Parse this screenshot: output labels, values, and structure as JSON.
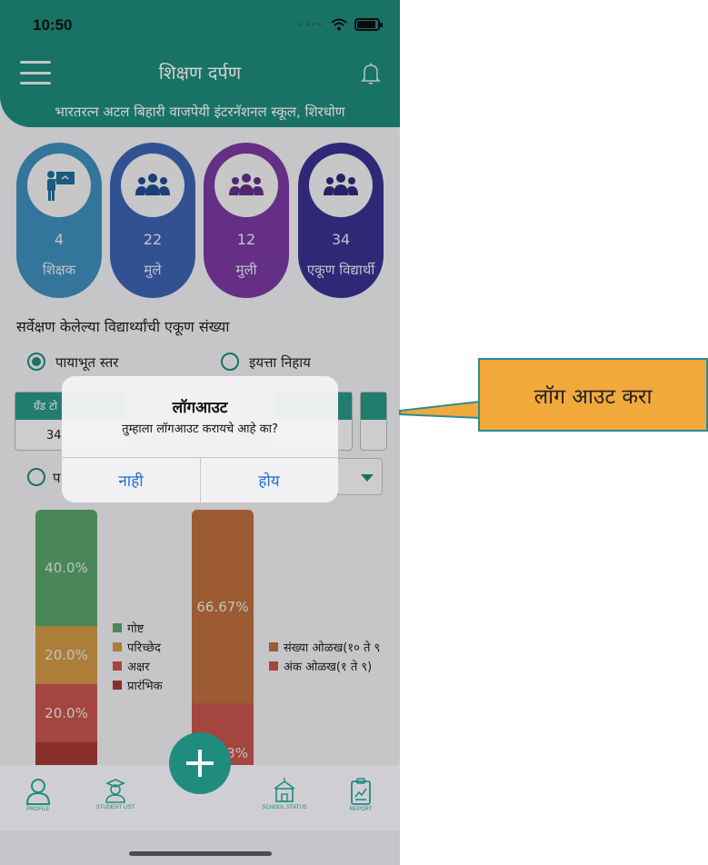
{
  "status_bar": {
    "time": "10:50"
  },
  "header": {
    "title": "शिक्षण दर्पण",
    "school": "भारतरत्न अटल बिहारी वाजपेयी इंटरनॅशनल स्कूल, शिरधोण"
  },
  "stats": [
    {
      "value": "4",
      "label": "शिक्षक",
      "color": "#3f8fbe",
      "icon": "teacher-icon"
    },
    {
      "value": "22",
      "label": "मुले",
      "color": "#3d63b3",
      "icon": "group-icon"
    },
    {
      "value": "12",
      "label": "मुली",
      "color": "#7a3aa1",
      "icon": "group-icon"
    },
    {
      "value": "34",
      "label": "एकूण विद्यार्थी",
      "color": "#3a3192",
      "icon": "group-icon"
    }
  ],
  "section": {
    "title": "सर्वेक्षण केलेल्या विद्यार्थ्यांची एकूण संख्या",
    "radio1": "पायाभूत स्तर",
    "radio2": "इयत्ता निहाय",
    "radio3_partial": "प",
    "table_head": "ग्रँड टो",
    "table_value": "34"
  },
  "chart_data": [
    {
      "type": "bar",
      "stacked": true,
      "series": [
        {
          "name": "गोष्ट",
          "value": 40.0,
          "label": "40.0%",
          "color": "#5aa56c"
        },
        {
          "name": "परिच्छेद",
          "value": 20.0,
          "label": "20.0%",
          "color": "#d39a47"
        },
        {
          "name": "अक्षर",
          "value": 20.0,
          "label": "20.0%",
          "color": "#c9554f"
        },
        {
          "name": "प्रारंभिक",
          "value": 20.0,
          "color": "#a73a36"
        }
      ]
    },
    {
      "type": "bar",
      "stacked": true,
      "series": [
        {
          "name": "संख्या ओळख(१० ते ९",
          "value": 66.67,
          "label": "66.67%",
          "color": "#c0703f"
        },
        {
          "name": "अंक ओळख(१ ते ९)",
          "value": 33.33,
          "label": "3%",
          "color": "#c9554f"
        }
      ]
    }
  ],
  "dialog": {
    "title": "लॉगआउट",
    "message": "तुम्हाला लॉगआउट करायचे आहे का?",
    "no": "नाही",
    "yes": "होय"
  },
  "nav": {
    "profile": "PROFILE",
    "student_list": "STUDENT LIST",
    "school_status": "SCHOOL STATUS",
    "report": "REPORT"
  },
  "callout": {
    "text": "लॉग आउट करा"
  }
}
